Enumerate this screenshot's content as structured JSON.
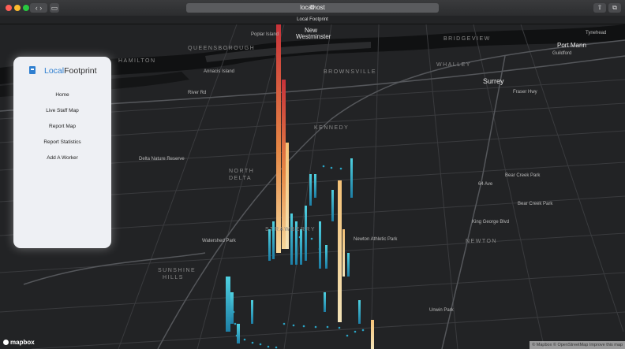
{
  "browser": {
    "url": "localhost",
    "tab_title": "Local Footprint",
    "back_icon": "chevron-left-icon",
    "forward_icon": "chevron-right-icon"
  },
  "panel": {
    "brand_local": "Local",
    "brand_footprint": "Footprint",
    "menu": [
      "Home",
      "Live Staff Map",
      "Report Map",
      "Report Statistics",
      "Add A Worker"
    ]
  },
  "map": {
    "labels": {
      "new_westminster_1": "New",
      "new_westminster_2": "Westminster",
      "port_mann": "Port Mann",
      "surrey": "Surrey",
      "queensborough": "QUEENSBOROUGH",
      "brownsville": "BROWNSVILLE",
      "whalley": "WHALLEY",
      "bridgeview": "BRIDGEVIEW",
      "hamilton": "HAMILTON",
      "kennedy": "KENNEDY",
      "north_delta_1": "NORTH",
      "north_delta_2": "DELTA",
      "sunshine_1": "SUNSHINE",
      "sunshine_2": "HILLS",
      "newton": "NEWTON",
      "strawberry": "STRAWBERRY",
      "bear_creek_1": "Bear Creek Park",
      "bear_creek_2": "Bear Creek Park",
      "newton_park": "Newton Athletic Park",
      "delta_nature": "Delta Nature Reserve",
      "watershed": "Watershed Park",
      "unwin": "Unwin Park",
      "fraser_hwy": "Fraser Hwy",
      "river_rd": "River Rd",
      "hwy_10": "64 Ave",
      "king_george": "King George Blvd",
      "poplar_island": "Poplar Island",
      "annacis": "Annacis Island",
      "tynehead": "Tynehead",
      "guildford": "Guildford"
    },
    "colors": {
      "bar_hot": "#c8323a",
      "bar_warm": "#f5c277",
      "bar_pale": "#f3e3b8",
      "bar_cool": "#2aa3c4"
    }
  },
  "footer": {
    "logo": "mapbox",
    "attribution": "© Mapbox © OpenStreetMap Improve this map"
  }
}
